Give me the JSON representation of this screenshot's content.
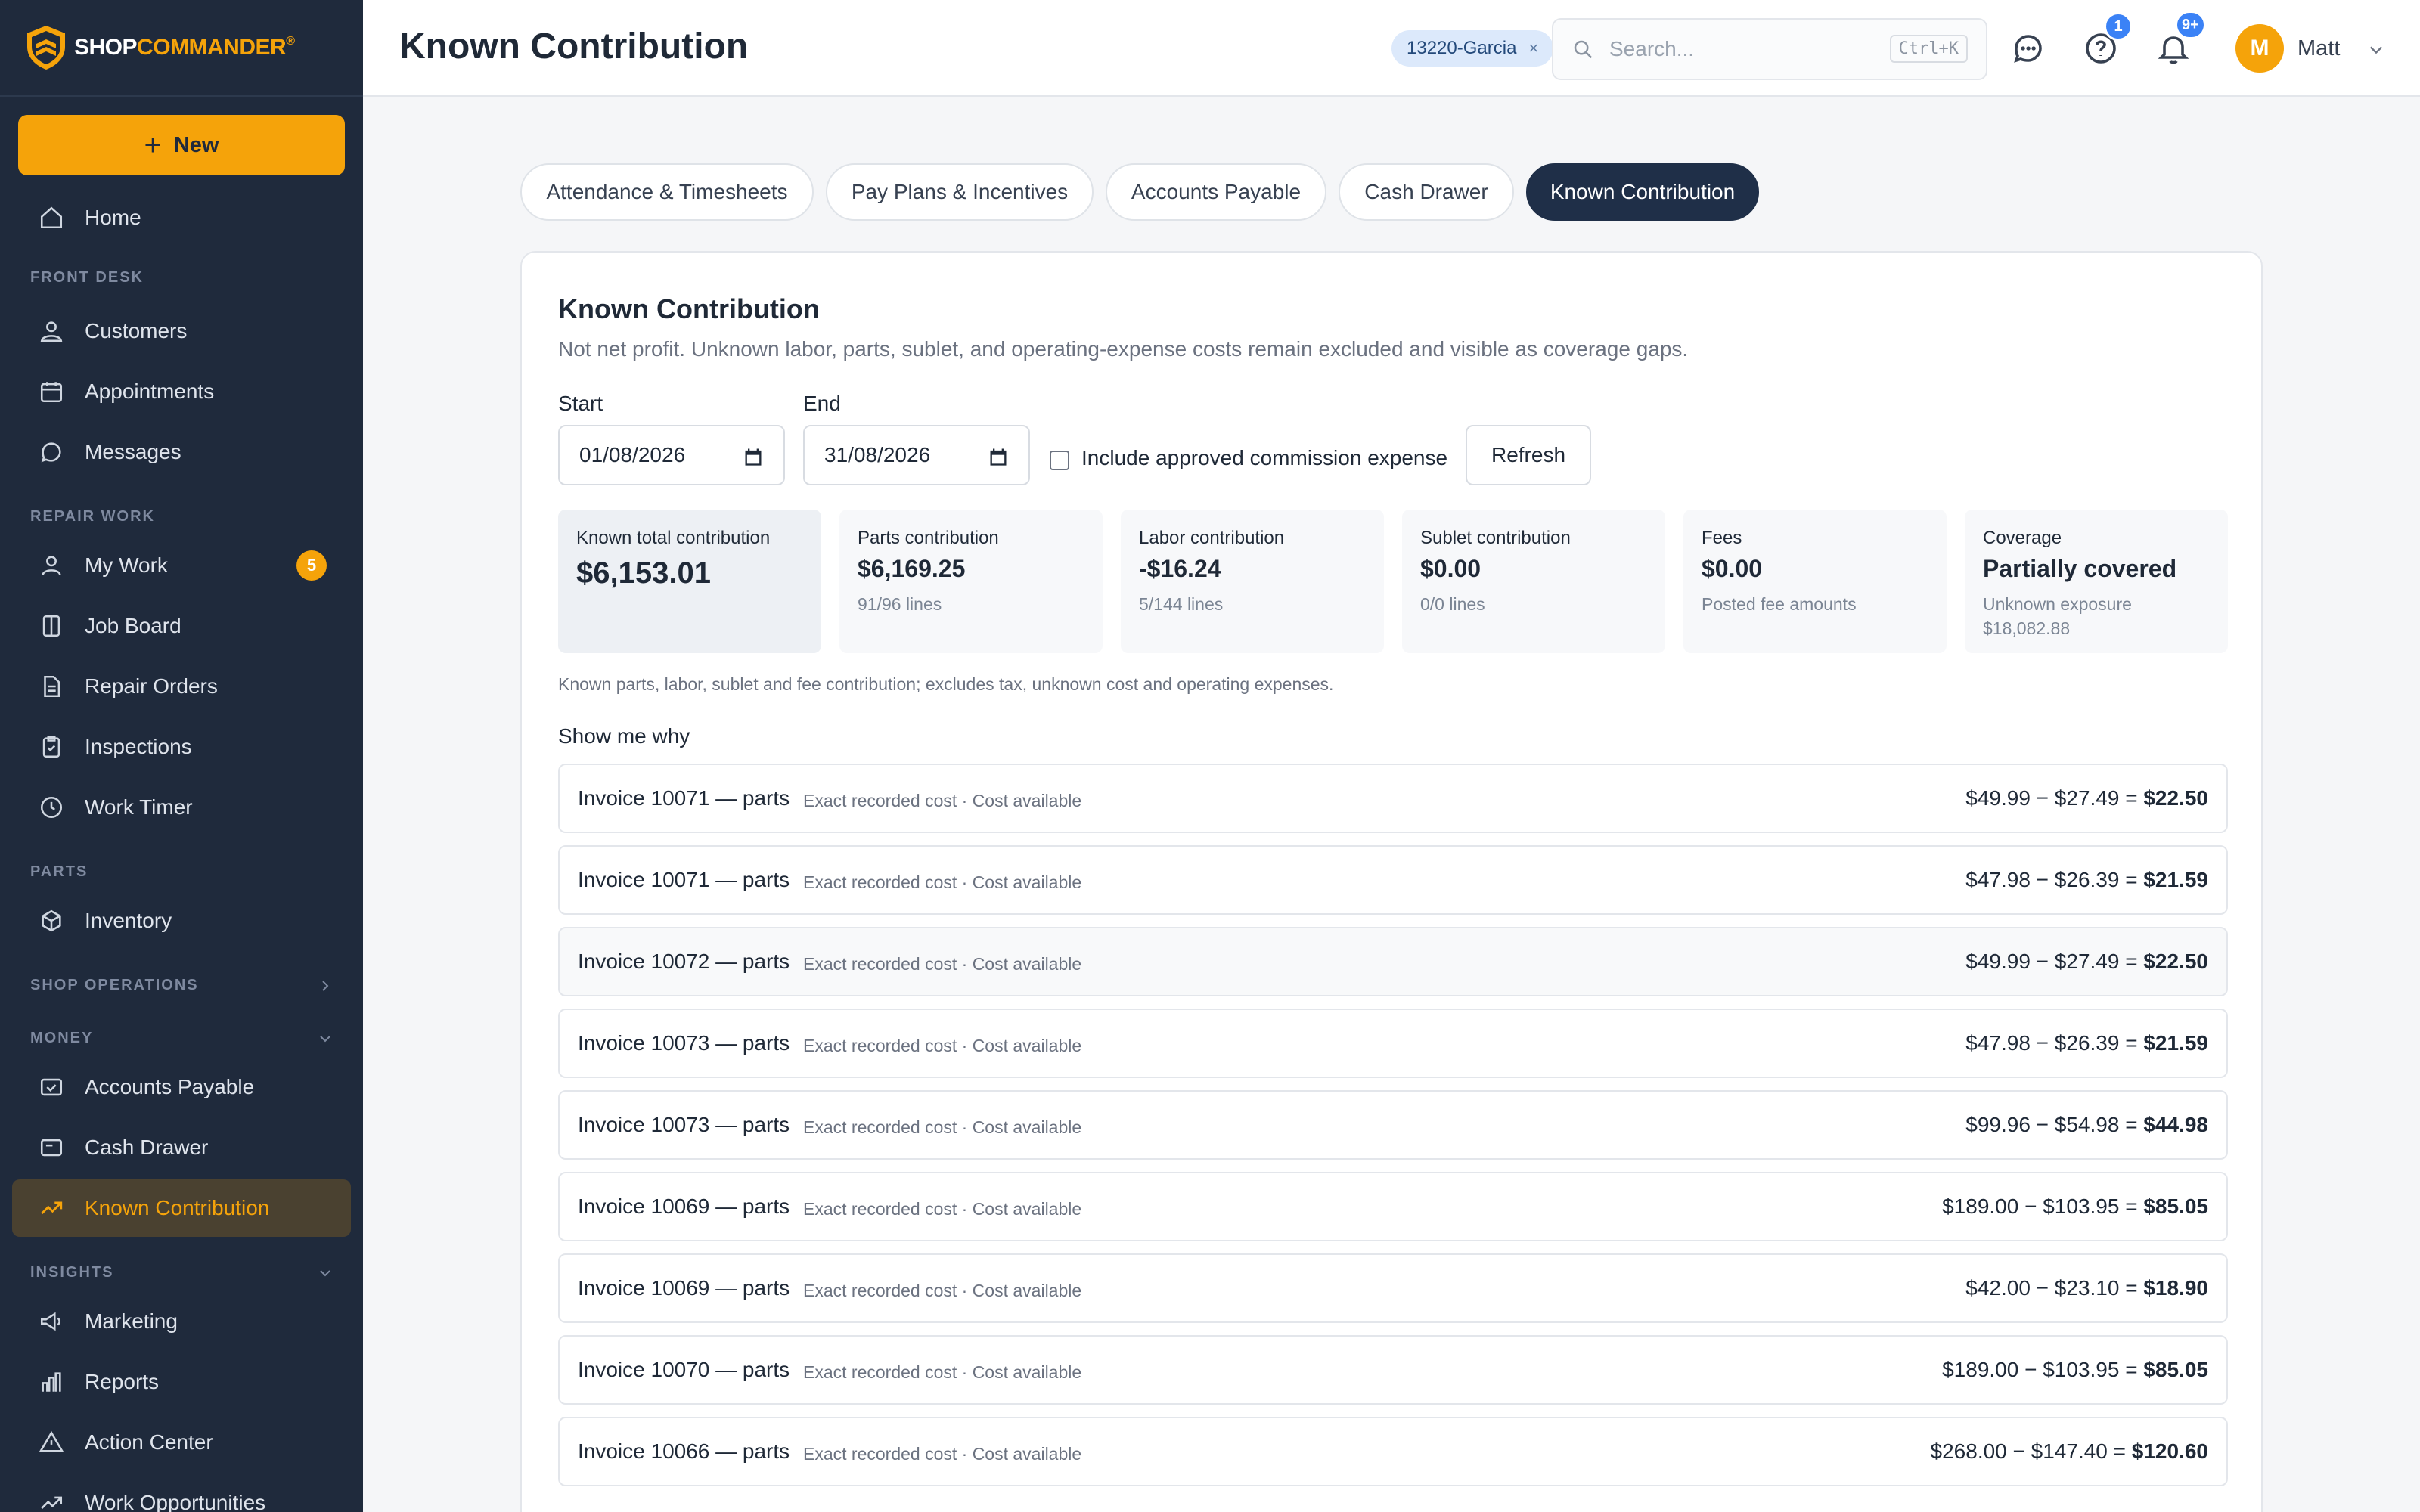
{
  "brand": {
    "part1": "SHOP",
    "part2": "COMMANDER",
    "mark": "®"
  },
  "sidebar": {
    "new_label": "New",
    "home": "Home",
    "sections": {
      "front_desk": "FRONT DESK",
      "repair_work": "REPAIR WORK",
      "parts": "PARTS",
      "shop_operations": "SHOP OPERATIONS",
      "money": "MONEY",
      "insights": "INSIGHTS"
    },
    "items": {
      "customers": "Customers",
      "appointments": "Appointments",
      "messages": "Messages",
      "my_work": "My Work",
      "my_work_badge": "5",
      "job_board": "Job Board",
      "repair_orders": "Repair Orders",
      "inspections": "Inspections",
      "work_timer": "Work Timer",
      "inventory": "Inventory",
      "accounts_payable": "Accounts Payable",
      "cash_drawer": "Cash Drawer",
      "known_contribution": "Known Contribution",
      "marketing": "Marketing",
      "reports": "Reports",
      "action_center": "Action Center",
      "work_opportunities": "Work Opportunities"
    }
  },
  "header": {
    "title": "Known Contribution",
    "chip": "13220-Garcia",
    "chip_close": "×",
    "search_placeholder": "Search...",
    "search_shortcut": "Ctrl+K",
    "help_badge": "1",
    "notif_badge": "9+",
    "avatar_initial": "M",
    "user_name": "Matt"
  },
  "tabs": [
    "Attendance & Timesheets",
    "Pay Plans & Incentives",
    "Accounts Payable",
    "Cash Drawer",
    "Known Contribution"
  ],
  "card": {
    "title": "Known Contribution",
    "subtitle": "Not net profit. Unknown labor, parts, sublet, and operating-expense costs remain excluded and visible as coverage gaps.",
    "start_label": "Start",
    "start_value": "01/08/2026",
    "end_label": "End",
    "end_value": "31/08/2026",
    "commission_label": "Include approved commission expense",
    "refresh_label": "Refresh",
    "note": "Known parts, labor, sublet and fee contribution; excludes tax, unknown cost and operating expenses.",
    "why_label": "Show me why"
  },
  "stats": [
    {
      "label": "Known total contribution",
      "value": "$6,153.01",
      "meta": ""
    },
    {
      "label": "Parts contribution",
      "value": "$6,169.25",
      "meta": "91/96 lines"
    },
    {
      "label": "Labor contribution",
      "value": "-$16.24",
      "meta": "5/144 lines"
    },
    {
      "label": "Sublet contribution",
      "value": "$0.00",
      "meta": "0/0 lines"
    },
    {
      "label": "Fees",
      "value": "$0.00",
      "meta": "Posted fee amounts"
    },
    {
      "label": "Coverage",
      "value": "Partially covered",
      "meta": "Unknown exposure",
      "meta2": "$18,082.88"
    }
  ],
  "rows": [
    {
      "title": "Invoice 10071 — parts",
      "meta": "Exact recorded cost · Cost available",
      "formula": "$49.99 − $27.49 = ",
      "result": "$22.50"
    },
    {
      "title": "Invoice 10071 — parts",
      "meta": "Exact recorded cost · Cost available",
      "formula": "$47.98 − $26.39 = ",
      "result": "$21.59"
    },
    {
      "title": "Invoice 10072 — parts",
      "meta": "Exact recorded cost · Cost available",
      "formula": "$49.99 − $27.49 = ",
      "result": "$22.50"
    },
    {
      "title": "Invoice 10073 — parts",
      "meta": "Exact recorded cost · Cost available",
      "formula": "$47.98 − $26.39 = ",
      "result": "$21.59"
    },
    {
      "title": "Invoice 10073 — parts",
      "meta": "Exact recorded cost · Cost available",
      "formula": "$99.96 − $54.98 = ",
      "result": "$44.98"
    },
    {
      "title": "Invoice 10069 — parts",
      "meta": "Exact recorded cost · Cost available",
      "formula": "$189.00 − $103.95 = ",
      "result": "$85.05"
    },
    {
      "title": "Invoice 10069 — parts",
      "meta": "Exact recorded cost · Cost available",
      "formula": "$42.00 − $23.10 = ",
      "result": "$18.90"
    },
    {
      "title": "Invoice 10070 — parts",
      "meta": "Exact recorded cost · Cost available",
      "formula": "$189.00 − $103.95 = ",
      "result": "$85.05"
    },
    {
      "title": "Invoice 10066 — parts",
      "meta": "Exact recorded cost · Cost available",
      "formula": "$268.00 − $147.40 = ",
      "result": "$120.60"
    }
  ],
  "colors": {
    "accent": "#f5a30a",
    "sidebar": "#1f2a3c",
    "active_tab": "#1f2f48",
    "badge_blue": "#3b82f6"
  }
}
